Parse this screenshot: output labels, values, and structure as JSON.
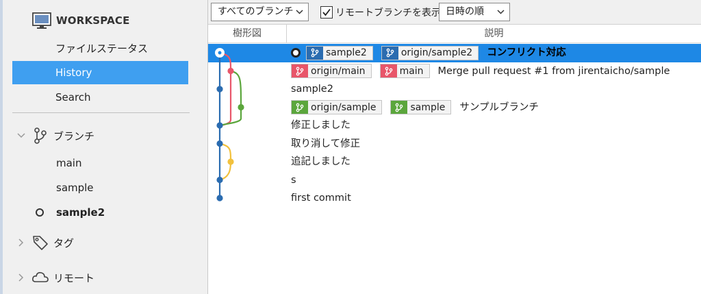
{
  "sidebar": {
    "workspace_label": "WORKSPACE",
    "nav": [
      {
        "label": "ファイルステータス"
      },
      {
        "label": "History"
      },
      {
        "label": "Search"
      }
    ],
    "groups": {
      "branches": "ブランチ",
      "tags": "タグ",
      "remotes": "リモート"
    },
    "branches": [
      {
        "label": "main"
      },
      {
        "label": "sample"
      },
      {
        "label": "sample2"
      }
    ]
  },
  "toolbar": {
    "branch_filter": "すべてのブランチ",
    "show_remote_label": "リモートブランチを表示",
    "show_remote_checked": true,
    "sort": "日時の順"
  },
  "columns": {
    "graph": "樹形図",
    "description": "説明"
  },
  "colors": {
    "blue": "#2b6cb0",
    "red": "#e8566a",
    "green": "#5ba63c",
    "yellow": "#f2c13d",
    "selection": "#1e88e5"
  },
  "commits": [
    {
      "message": "コンフリクト対応",
      "refs": [
        "sample2",
        "origin/sample2"
      ]
    },
    {
      "message": "Merge pull request #1 from jirentaicho/sample",
      "refs": [
        "origin/main",
        "main"
      ]
    },
    {
      "message": "sample2",
      "refs": []
    },
    {
      "message": "サンプルブランチ",
      "refs": [
        "origin/sample",
        "sample"
      ]
    },
    {
      "message": "修正しました",
      "refs": []
    },
    {
      "message": "取り消して修正",
      "refs": []
    },
    {
      "message": "追記しました",
      "refs": []
    },
    {
      "message": "s",
      "refs": []
    },
    {
      "message": "first commit",
      "refs": []
    }
  ]
}
